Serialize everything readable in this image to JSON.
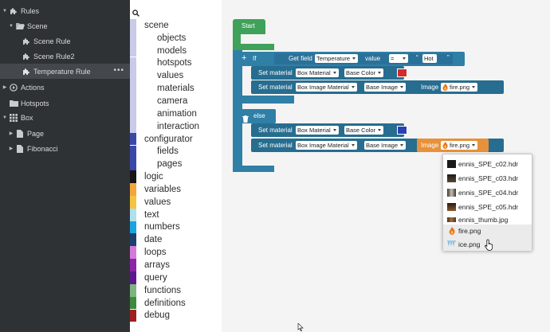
{
  "sidebar": {
    "rules": "Rules",
    "scene": "Scene",
    "scene_rule": "Scene Rule",
    "scene_rule2": "Scene Rule2",
    "temperature_rule": "Temperature Rule",
    "actions": "Actions",
    "hotspots": "Hotspots",
    "box": "Box",
    "page": "Page",
    "fibonacci": "Fibonacci",
    "more": "•••"
  },
  "toolbox": {
    "categories": [
      {
        "label": "scene",
        "color": "#c9cbe8",
        "indent": 0
      },
      {
        "label": "objects",
        "color": "#c9cbe8",
        "indent": 1
      },
      {
        "label": "models",
        "color": "#c9cbe8",
        "indent": 1
      },
      {
        "label": "hotspots",
        "color": "#c9cbe8",
        "indent": 1
      },
      {
        "label": "values",
        "color": "#c9cbe8",
        "indent": 1
      },
      {
        "label": "materials",
        "color": "#c9cbe8",
        "indent": 1
      },
      {
        "label": "camera",
        "color": "#c9cbe8",
        "indent": 1
      },
      {
        "label": "animation",
        "color": "#c9cbe8",
        "indent": 1
      },
      {
        "label": "interaction",
        "color": "#c9cbe8",
        "indent": 1
      },
      {
        "label": "configurator",
        "color": "#3a48a8",
        "indent": 0
      },
      {
        "label": "fields",
        "color": "#3a48a8",
        "indent": 1
      },
      {
        "label": "pages",
        "color": "#3a48a8",
        "indent": 1
      },
      {
        "label": "logic",
        "color": "#161616",
        "indent": 0
      },
      {
        "label": "variables",
        "color": "#f4a63d",
        "indent": 0
      },
      {
        "label": "values",
        "color": "#f3c53e",
        "indent": 0
      },
      {
        "label": "text",
        "color": "#aee0ee",
        "indent": 0
      },
      {
        "label": "numbers",
        "color": "#1aa3e0",
        "indent": 0
      },
      {
        "label": "date",
        "color": "#1d3f6c",
        "indent": 0
      },
      {
        "label": "loops",
        "color": "#d47ad8",
        "indent": 0
      },
      {
        "label": "arrays",
        "color": "#8e24aa",
        "indent": 0
      },
      {
        "label": "query",
        "color": "#5c1a8f",
        "indent": 0
      },
      {
        "label": "functions",
        "color": "#7cb57f",
        "indent": 0
      },
      {
        "label": "definitions",
        "color": "#3c8a3e",
        "indent": 0
      },
      {
        "label": "debug",
        "color": "#9e2020",
        "indent": 0
      }
    ]
  },
  "blocks": {
    "start": "Start",
    "plus": "+",
    "if": "If",
    "get_field": "Get field",
    "field_name": "Temperature",
    "value": "value",
    "operator": "=",
    "hot_text": "Hot",
    "quote_open": "“",
    "quote_close": "”",
    "set_material": "Set material",
    "box_material": "Box Material",
    "base_color": "Base Color",
    "box_image_material": "Box Image Material",
    "base_image": "Base Image",
    "image": "Image",
    "fire_png": "fire.png",
    "else": "else",
    "red": "#d32b2b",
    "blue": "#2b3fb5"
  },
  "menu": {
    "items": [
      {
        "label": "ennis_SPE_c02.hdr",
        "thumb": "#1a1a1a"
      },
      {
        "label": "ennis_SPE_c03.hdr",
        "thumb": "#3a2e24"
      },
      {
        "label": "ennis_SPE_c04.hdr",
        "thumb": "#8a8070"
      },
      {
        "label": "ennis_SPE_c05.hdr",
        "thumb": "#5a3a20"
      },
      {
        "label": "ennis_thumb.jpg",
        "thumb": "#6b4a2a"
      },
      {
        "label": "fire.png",
        "thumb": "fire-icon"
      },
      {
        "label": "ice.png",
        "thumb": "ice-icon"
      }
    ]
  }
}
